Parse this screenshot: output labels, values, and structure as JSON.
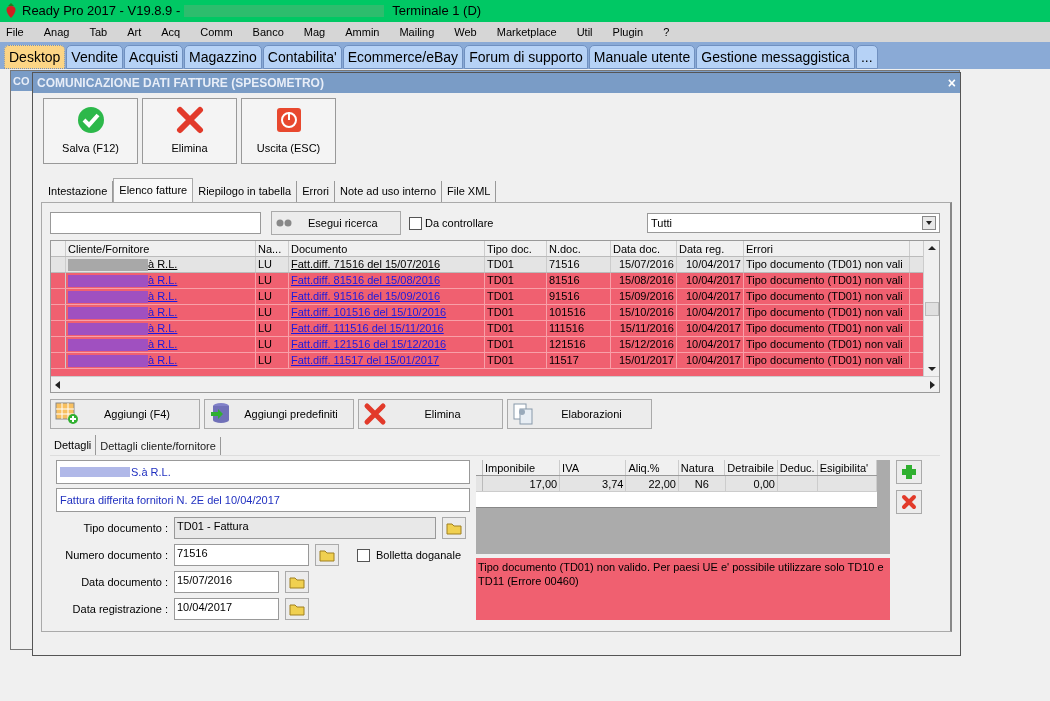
{
  "window": {
    "title_prefix": "Ready Pro 2017 - V19.8.9 -",
    "title_suffix": "Terminale 1 (D)"
  },
  "menu": [
    "File",
    "Anag",
    "Tab",
    "Art",
    "Acq",
    "Comm",
    "Banco",
    "Mag",
    "Ammin",
    "Mailing",
    "Web",
    "Marketplace",
    "Util",
    "Plugin",
    "?"
  ],
  "main_tabs": [
    {
      "label": "Desktop",
      "selected": true
    },
    {
      "label": "Vendite",
      "selected": false
    },
    {
      "label": "Acquisti",
      "selected": false
    },
    {
      "label": "Magazzino",
      "selected": false
    },
    {
      "label": "Contabilita'",
      "selected": false
    },
    {
      "label": "Ecommerce/eBay",
      "selected": false
    },
    {
      "label": "Forum di supporto",
      "selected": false
    },
    {
      "label": "Manuale utente",
      "selected": false
    },
    {
      "label": "Gestione messaggistica",
      "selected": false
    },
    {
      "label": "...",
      "selected": false
    }
  ],
  "background_window": {
    "title": "CO"
  },
  "dialog": {
    "title": "COMUNICAZIONE DATI FATTURE (SPESOMETRO)",
    "close": "×"
  },
  "toolbar": [
    {
      "kind": "save",
      "label": "Salva (F12)"
    },
    {
      "kind": "delete",
      "label": "Elimina"
    },
    {
      "kind": "exit",
      "label": "Uscita (ESC)"
    }
  ],
  "tabs": [
    {
      "label": "Intestazione",
      "selected": false
    },
    {
      "label": "Elenco fatture",
      "selected": true
    },
    {
      "label": "Riepilogo in tabella",
      "selected": false
    },
    {
      "label": "Errori",
      "selected": false
    },
    {
      "label": "Note ad uso interno",
      "selected": false
    },
    {
      "label": "File XML",
      "selected": false
    }
  ],
  "search": {
    "button": "Esegui ricerca",
    "checkbox": {
      "label": "Da controllare",
      "checked": false
    },
    "filter": "Tutti"
  },
  "table": {
    "columns": [
      "Cliente/Fornitore",
      "Na...",
      "Documento",
      "Tipo doc.",
      "N.doc.",
      "Data doc.",
      "Data reg.",
      "Errori"
    ],
    "rows": [
      {
        "selected": true,
        "cells": [
          "à R.L.",
          "LU",
          "Fatt.diff. 71516 del 15/07/2016",
          "TD01",
          "71516",
          "15/07/2016",
          "10/04/2017",
          "Tipo documento (TD01) non vali"
        ]
      },
      {
        "selected": false,
        "cells": [
          "à R.L.",
          "LU",
          "Fatt.diff. 81516 del 15/08/2016",
          "TD01",
          "81516",
          "15/08/2016",
          "10/04/2017",
          "Tipo documento (TD01) non vali"
        ]
      },
      {
        "selected": false,
        "cells": [
          "à R.L.",
          "LU",
          "Fatt.diff. 91516 del 15/09/2016",
          "TD01",
          "91516",
          "15/09/2016",
          "10/04/2017",
          "Tipo documento (TD01) non vali"
        ]
      },
      {
        "selected": false,
        "cells": [
          "à R.L.",
          "LU",
          "Fatt.diff. 101516 del 15/10/2016",
          "TD01",
          "101516",
          "15/10/2016",
          "10/04/2017",
          "Tipo documento (TD01) non vali"
        ]
      },
      {
        "selected": false,
        "cells": [
          "à R.L.",
          "LU",
          "Fatt.diff. 111516 del 15/11/2016",
          "TD01",
          "111516",
          "15/11/2016",
          "10/04/2017",
          "Tipo documento (TD01) non vali"
        ]
      },
      {
        "selected": false,
        "cells": [
          "à R.L.",
          "LU",
          "Fatt.diff. 121516 del 15/12/2016",
          "TD01",
          "121516",
          "15/12/2016",
          "10/04/2017",
          "Tipo documento (TD01) non vali"
        ]
      },
      {
        "selected": false,
        "cells": [
          "à R.L.",
          "LU",
          "Fatt.diff. 11517 del 15/01/2017",
          "TD01",
          "11517",
          "15/01/2017",
          "10/04/2017",
          "Tipo documento (TD01) non vali"
        ]
      }
    ]
  },
  "actions": [
    {
      "kind": "add",
      "label": "Aggiungi (F4)"
    },
    {
      "kind": "preset",
      "label": "Aggiungi predefiniti"
    },
    {
      "kind": "delete",
      "label": "Elimina"
    },
    {
      "kind": "process",
      "label": "Elaborazioni"
    }
  ],
  "detail_tabs": [
    {
      "label": "Dettagli",
      "selected": true
    },
    {
      "label": "Dettagli cliente/fornitore",
      "selected": false
    }
  ],
  "details": {
    "client": "S.à R.L.",
    "description": "Fattura differita fornitori N. 2E del 10/04/2017",
    "fields": [
      {
        "label": "Tipo documento :",
        "value": "TD01 - Fattura",
        "kind": "readonly"
      },
      {
        "label": "Numero documento :",
        "value": "71516",
        "kind": "number"
      },
      {
        "label": "Data documento :",
        "value": "15/07/2016",
        "kind": "date"
      },
      {
        "label": "Data registrazione :",
        "value": "10/04/2017",
        "kind": "date"
      }
    ],
    "customs": {
      "label": "Bolletta doganale",
      "checked": false
    }
  },
  "vat_table": {
    "columns": [
      "Imponibile",
      "IVA",
      "Aliq.%",
      "Natura",
      "Detraibile",
      "Deduc.",
      "Esigibilita'"
    ],
    "rows": [
      [
        "17,00",
        "3,74",
        "22,00",
        "N6",
        "0,00",
        "",
        ""
      ]
    ]
  },
  "error_message": "Tipo documento (TD01) non valido. Per paesi UE e' possibile utilizzare solo TD10 e TD11 (Errore 00460)"
}
